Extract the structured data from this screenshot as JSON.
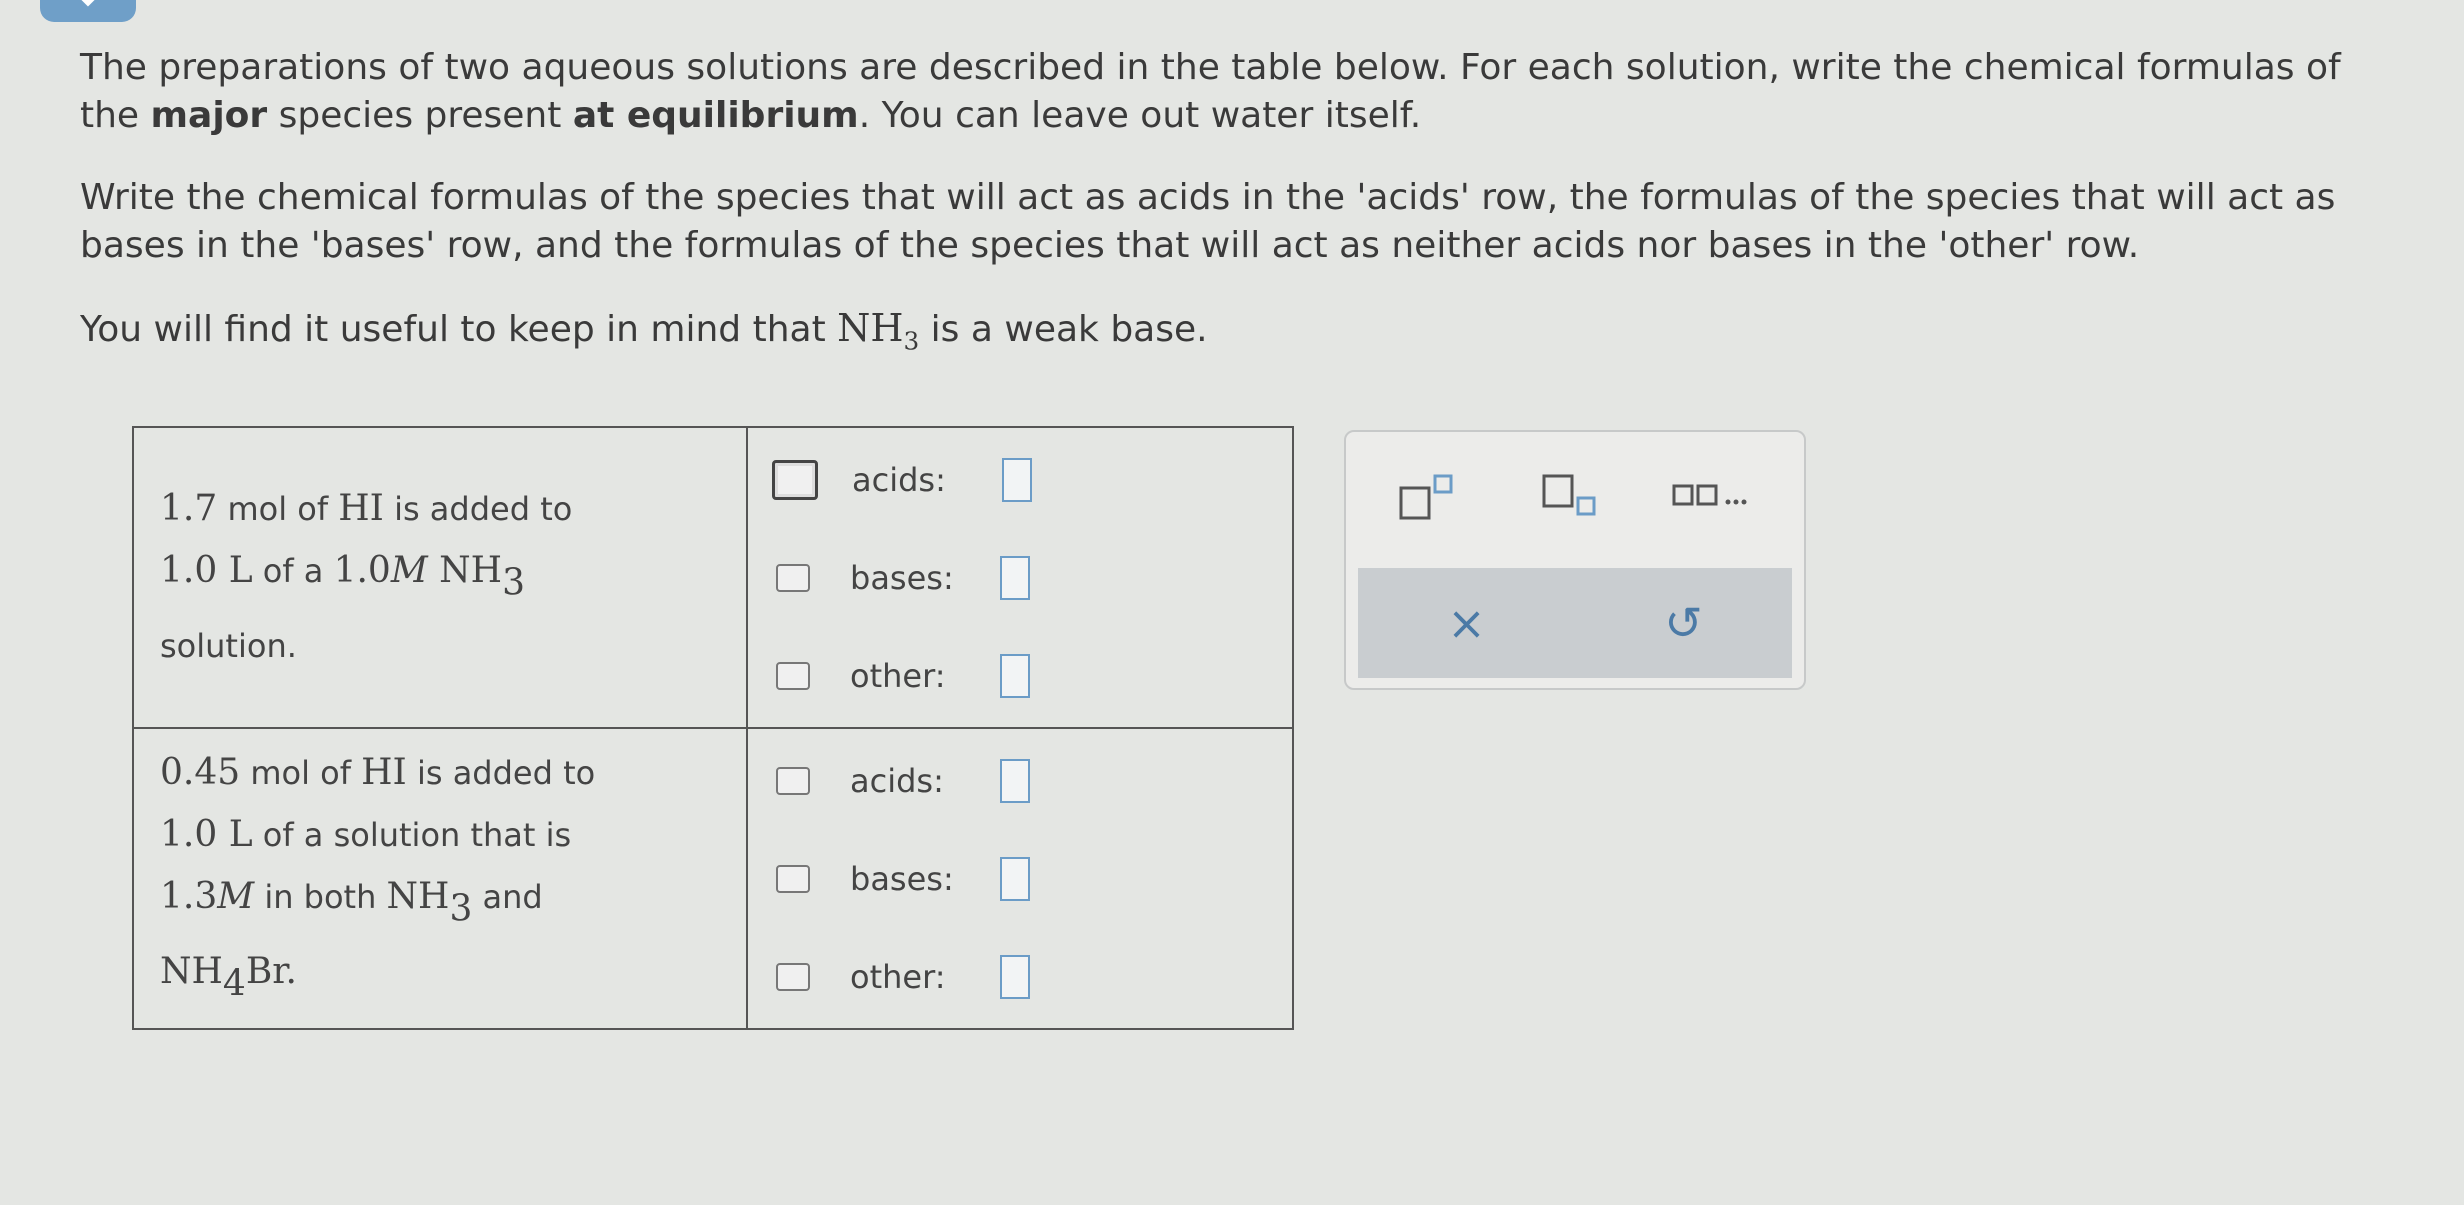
{
  "instructions": {
    "p1_a": "The preparations of two aqueous solutions are described in the table below. For each solution, write the chemical formulas of the ",
    "p1_bold1": "major",
    "p1_b": " species present ",
    "p1_bold2": "at equilibrium",
    "p1_c": ". You can leave out water itself.",
    "p2": "Write the chemical formulas of the species that will act as acids in the 'acids' row, the formulas of the species that will act as bases in the 'bases' row, and the formulas of the species that will act as neither acids nor bases in the 'other' row.",
    "p3_a": "You will find it useful to keep in mind that ",
    "p3_formula": "NH",
    "p3_sub": "3",
    "p3_b": " is a weak base."
  },
  "problems": [
    {
      "line1_num": "1.7",
      "line1_text": " mol of ",
      "line1_formula": "HI",
      "line1_end": " is added to",
      "line2_num": "1.0 L",
      "line2_text": " of a ",
      "line2_formula": "1.0",
      "line2_M": "M",
      "line2_species": " NH",
      "line2_sub": "3",
      "line3": "solution.",
      "labels": [
        "acids:",
        "bases:",
        "other:"
      ]
    },
    {
      "line1_num": "0.45",
      "line1_text": " mol of ",
      "line1_formula": "HI",
      "line1_end": " is added to",
      "line2_num": "1.0 L",
      "line2_text": " of a solution that is",
      "line3_num": "1.3",
      "line3_M": "M",
      "line3_text": " in both ",
      "line3_formula": "NH",
      "line3_sub": "3",
      "line3_end": " and",
      "line4_formula": "NH",
      "line4_sub": "4",
      "line4_end": "Br.",
      "labels": [
        "acids:",
        "bases:",
        "other:"
      ]
    }
  ],
  "toolbar": {
    "buttons": [
      "superscript-icon",
      "subscript-icon",
      "ellipsis-dots-icon"
    ],
    "clear_symbol": "×",
    "undo_symbol": "↺"
  },
  "colors": {
    "accent": "#6b9cc7",
    "background": "#e4e6e3",
    "text": "#3a3a3a"
  }
}
